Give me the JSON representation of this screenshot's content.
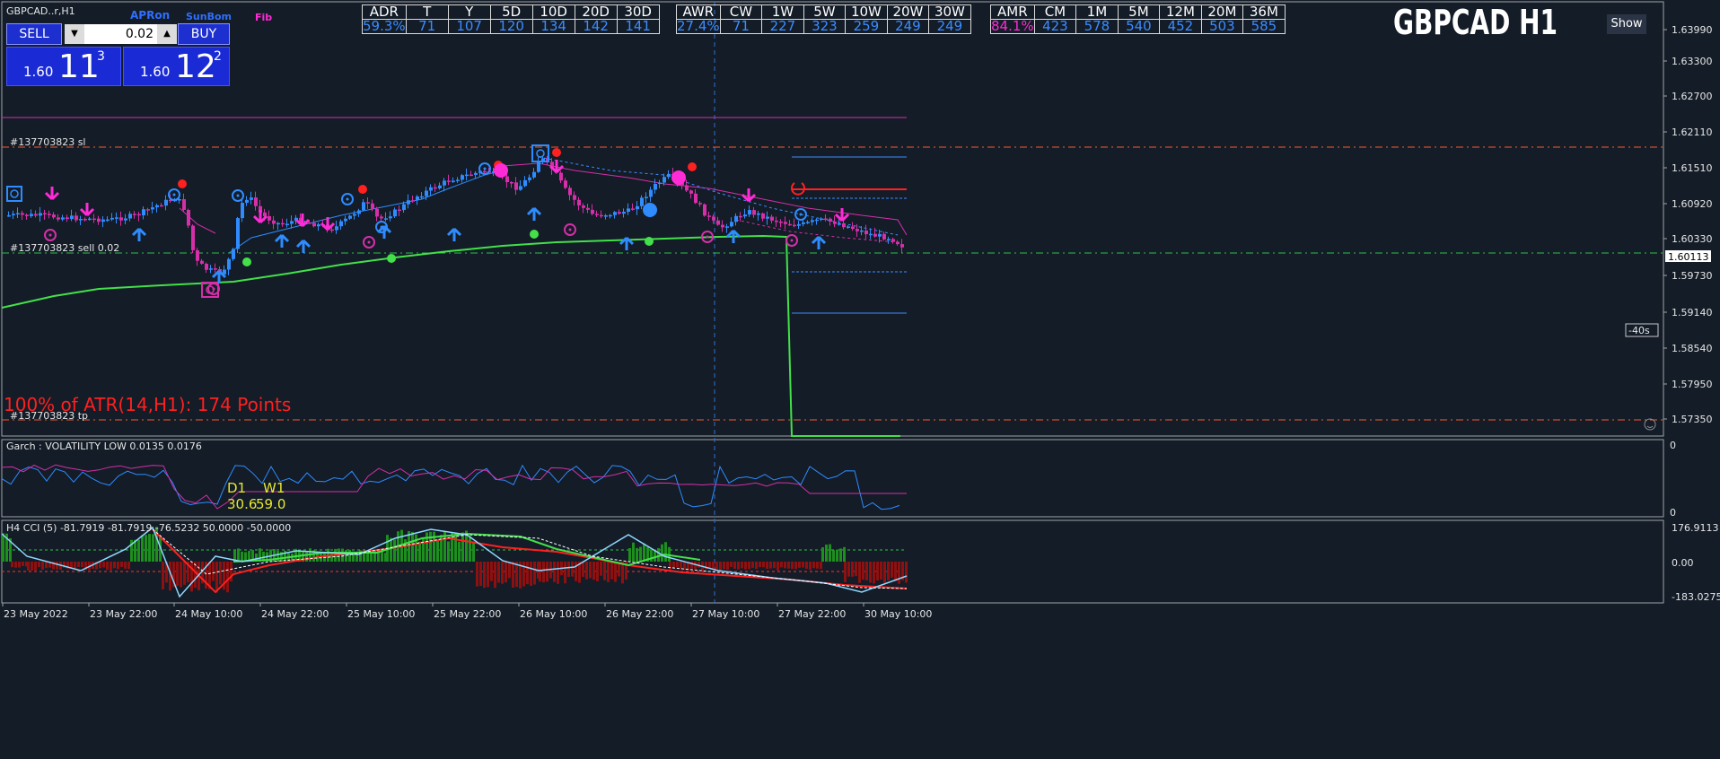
{
  "header": {
    "symbol_label": "GBPCAD..r,H1",
    "chart_title": "GBPCAD H1",
    "apron_label": "APRon",
    "sunbom_label": "SunBom",
    "fib_label": "Fib",
    "show_button": "Show"
  },
  "trade_panel": {
    "sell_label": "SELL",
    "buy_label": "BUY",
    "lot_value": "0.02",
    "down_arrow": "▼",
    "up_arrow": "▲",
    "sell_price": {
      "prefix": "1.60",
      "big": "11",
      "sup": "3"
    },
    "buy_price": {
      "prefix": "1.60",
      "big": "12",
      "sup": "2"
    }
  },
  "adr_table": {
    "headers": [
      "ADR",
      "T",
      "Y",
      "5D",
      "10D",
      "20D",
      "30D"
    ],
    "values": [
      "59.3%",
      "71",
      "107",
      "120",
      "134",
      "142",
      "141"
    ]
  },
  "awr_table": {
    "headers": [
      "AWR",
      "CW",
      "1W",
      "5W",
      "10W",
      "20W",
      "30W"
    ],
    "values": [
      "27.4%",
      "71",
      "227",
      "323",
      "259",
      "249",
      "249"
    ]
  },
  "amr_table": {
    "headers": [
      "AMR",
      "CM",
      "1M",
      "5M",
      "12M",
      "20M",
      "36M"
    ],
    "values": [
      "84.1%",
      "423",
      "578",
      "540",
      "452",
      "503",
      "585"
    ]
  },
  "price_axis": {
    "ticks": [
      "1.63990",
      "1.63300",
      "1.62700",
      "1.62110",
      "1.61510",
      "1.60920",
      "1.60330",
      "1.59730",
      "1.59140",
      "1.58540",
      "1.57950",
      "1.57350"
    ],
    "current_price": "1.60113",
    "timer": "-40s"
  },
  "chart_labels": {
    "sl_label": "#137703823 sl",
    "sell_label": "#137703823 sell 0.02",
    "tp_label": "#137703823 tp",
    "atr_text": "100% of ATR(14,H1): 174  Points"
  },
  "garch_panel": {
    "title": "Garch : VOLATILITY LOW 0.0135 0.0176",
    "d1_label": "D1",
    "w1_label": "W1",
    "d1_value": "30.6",
    "w1_value": "59.0",
    "axis_top": "0",
    "axis_bottom": "0"
  },
  "cci_panel": {
    "title": "H4 CCI (5) -81.7919 -81.7919 -76.5232 50.0000 -50.0000",
    "axis_ticks": [
      "176.9113",
      "0.00",
      "-183.0275"
    ]
  },
  "time_axis": {
    "labels": [
      "23 May 2022",
      "23 May 22:00",
      "24 May 10:00",
      "24 May 22:00",
      "25 May 10:00",
      "25 May 22:00",
      "26 May 10:00",
      "26 May 22:00",
      "27 May 10:00",
      "27 May 22:00",
      "30 May 10:00"
    ]
  },
  "colors": {
    "background": "#131c27",
    "bull": "#2f8cff",
    "bear": "#d62fa8",
    "ma_green": "#43e04a",
    "sl_line": "#ff5a2b",
    "magenta": "#ff2bd6",
    "red": "#ff2020",
    "yellow": "#e8e830"
  }
}
